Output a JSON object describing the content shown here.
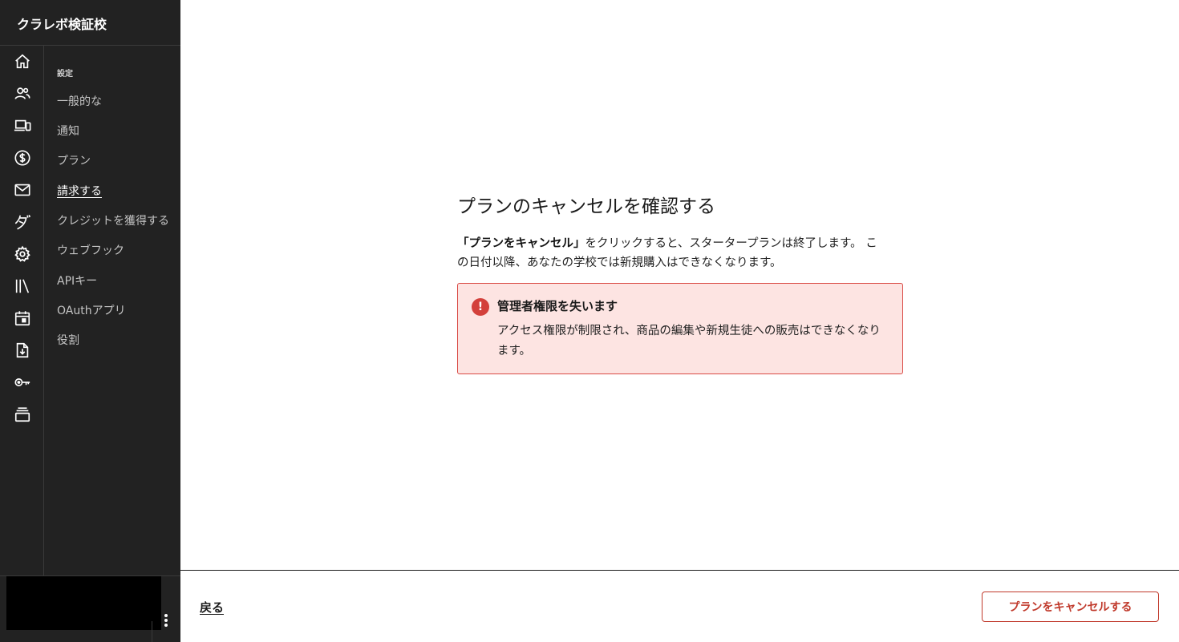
{
  "sidebar": {
    "school_name": "クラレボ検証校",
    "rail_icons": [
      "home-icon",
      "users-icon",
      "devices-icon",
      "dollar-icon",
      "mail-icon",
      "katakana-da-icon",
      "gear-icon",
      "library-icon",
      "calendar-icon",
      "download-icon",
      "key-icon",
      "stack-icon"
    ],
    "submenu": {
      "heading": "設定",
      "items": [
        {
          "label": "一般的な"
        },
        {
          "label": "通知"
        },
        {
          "label": "プラン"
        },
        {
          "label": "請求する",
          "active": true
        },
        {
          "label": "クレジットを獲得する"
        },
        {
          "label": "ウェブフック"
        },
        {
          "label": "APIキー"
        },
        {
          "label": "OAuthアプリ"
        },
        {
          "label": "役割"
        }
      ]
    }
  },
  "dialog": {
    "title": "プランのキャンセルを確認する",
    "body_strong": "「プランをキャンセル」",
    "body_rest": "をクリックすると、スタータープランは終了します。 この日付以降、あなたの学校では新規購入はできなくなります。",
    "alert": {
      "icon": "!",
      "title": "管理者権限を失います",
      "text": "アクセス権限が制限され、商品の編集や新規生徒への販売はできなくなります。",
      "color": "#d3403b"
    }
  },
  "footer": {
    "back_label": "戻る",
    "cancel_label": "プランをキャンセルする",
    "danger_color": "#c0392b"
  }
}
